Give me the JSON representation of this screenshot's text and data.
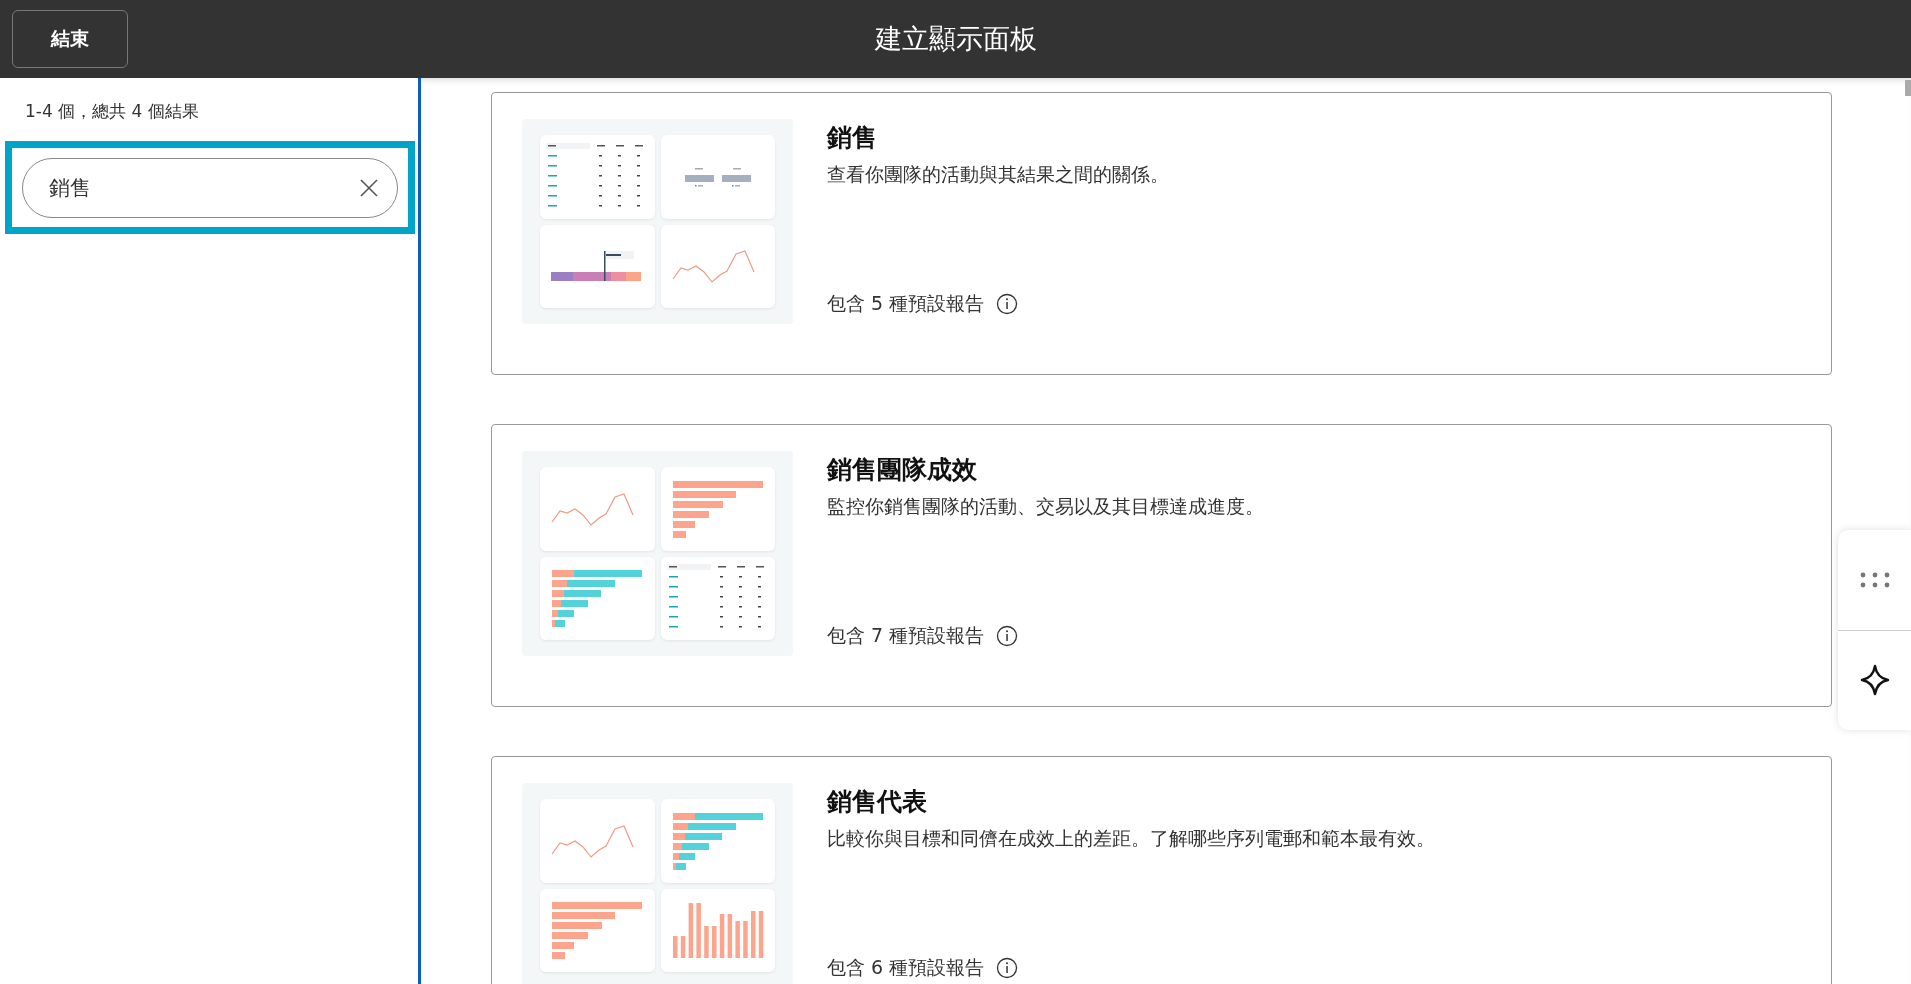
{
  "header": {
    "end_button": "結束",
    "title": "建立顯示面板"
  },
  "sidebar": {
    "result_count": "1-4 個，總共 4 個結果",
    "search": {
      "value": "銷售"
    }
  },
  "templates": [
    {
      "title": "銷售",
      "description": "查看你團隊的活動與其結果之間的關係。",
      "reports": "包含 5 種預設報告",
      "thumbnail": [
        {
          "kind": "table"
        },
        {
          "kind": "kpi"
        },
        {
          "kind": "gauge"
        },
        {
          "kind": "line"
        }
      ]
    },
    {
      "title": "銷售團隊成效",
      "description": "監控你銷售團隊的活動、交易以及其目標達成進度。",
      "reports": "包含 7 種預設報告",
      "thumbnail": [
        {
          "kind": "line"
        },
        {
          "kind": "hbar"
        },
        {
          "kind": "stacked"
        },
        {
          "kind": "table"
        }
      ]
    },
    {
      "title": "銷售代表",
      "description": "比較你與目標和同儕在成效上的差距。了解哪些序列電郵和範本最有效。",
      "reports": "包含 6 種預設報告",
      "thumbnail": [
        {
          "kind": "line"
        },
        {
          "kind": "stacked"
        },
        {
          "kind": "hbar"
        },
        {
          "kind": "vbar"
        }
      ]
    }
  ]
}
